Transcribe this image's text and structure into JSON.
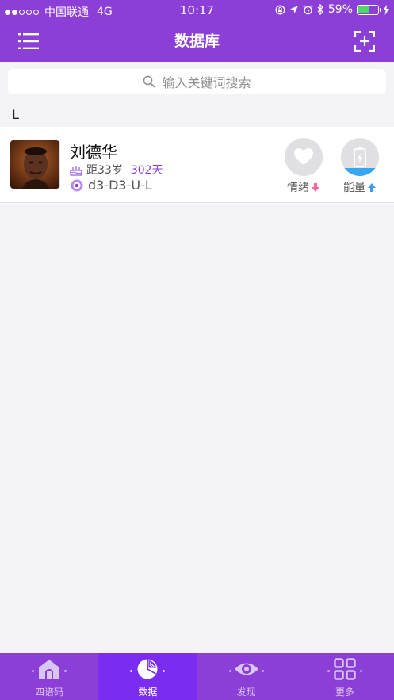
{
  "status": {
    "carrier": "中国联通",
    "network": "4G",
    "time": "10:17",
    "battery": "59%",
    "battery_level": 0.59
  },
  "header": {
    "title": "数据库",
    "menu_icon": "list-menu-icon",
    "add_icon": "add-square-icon"
  },
  "search": {
    "placeholder": "输入关键词搜索"
  },
  "section": {
    "letter": "L"
  },
  "contact": {
    "name": "刘德华",
    "age_text": "距33岁",
    "days": "302天",
    "code": "d3-D3-U-L",
    "emotion_label": "情绪",
    "energy_label": "能量",
    "energy_level": 0.2
  },
  "tabs": [
    {
      "label": "四谱码",
      "icon": "home-icon"
    },
    {
      "label": "数据",
      "icon": "pie-chart-icon"
    },
    {
      "label": "发现",
      "icon": "eye-icon"
    },
    {
      "label": "更多",
      "icon": "grid-icon"
    }
  ],
  "colors": {
    "brand": "#8b3fd6",
    "active_tab": "#7a2df0",
    "energy": "#37a7f0",
    "emotion_arrow": "#f06aa0"
  }
}
